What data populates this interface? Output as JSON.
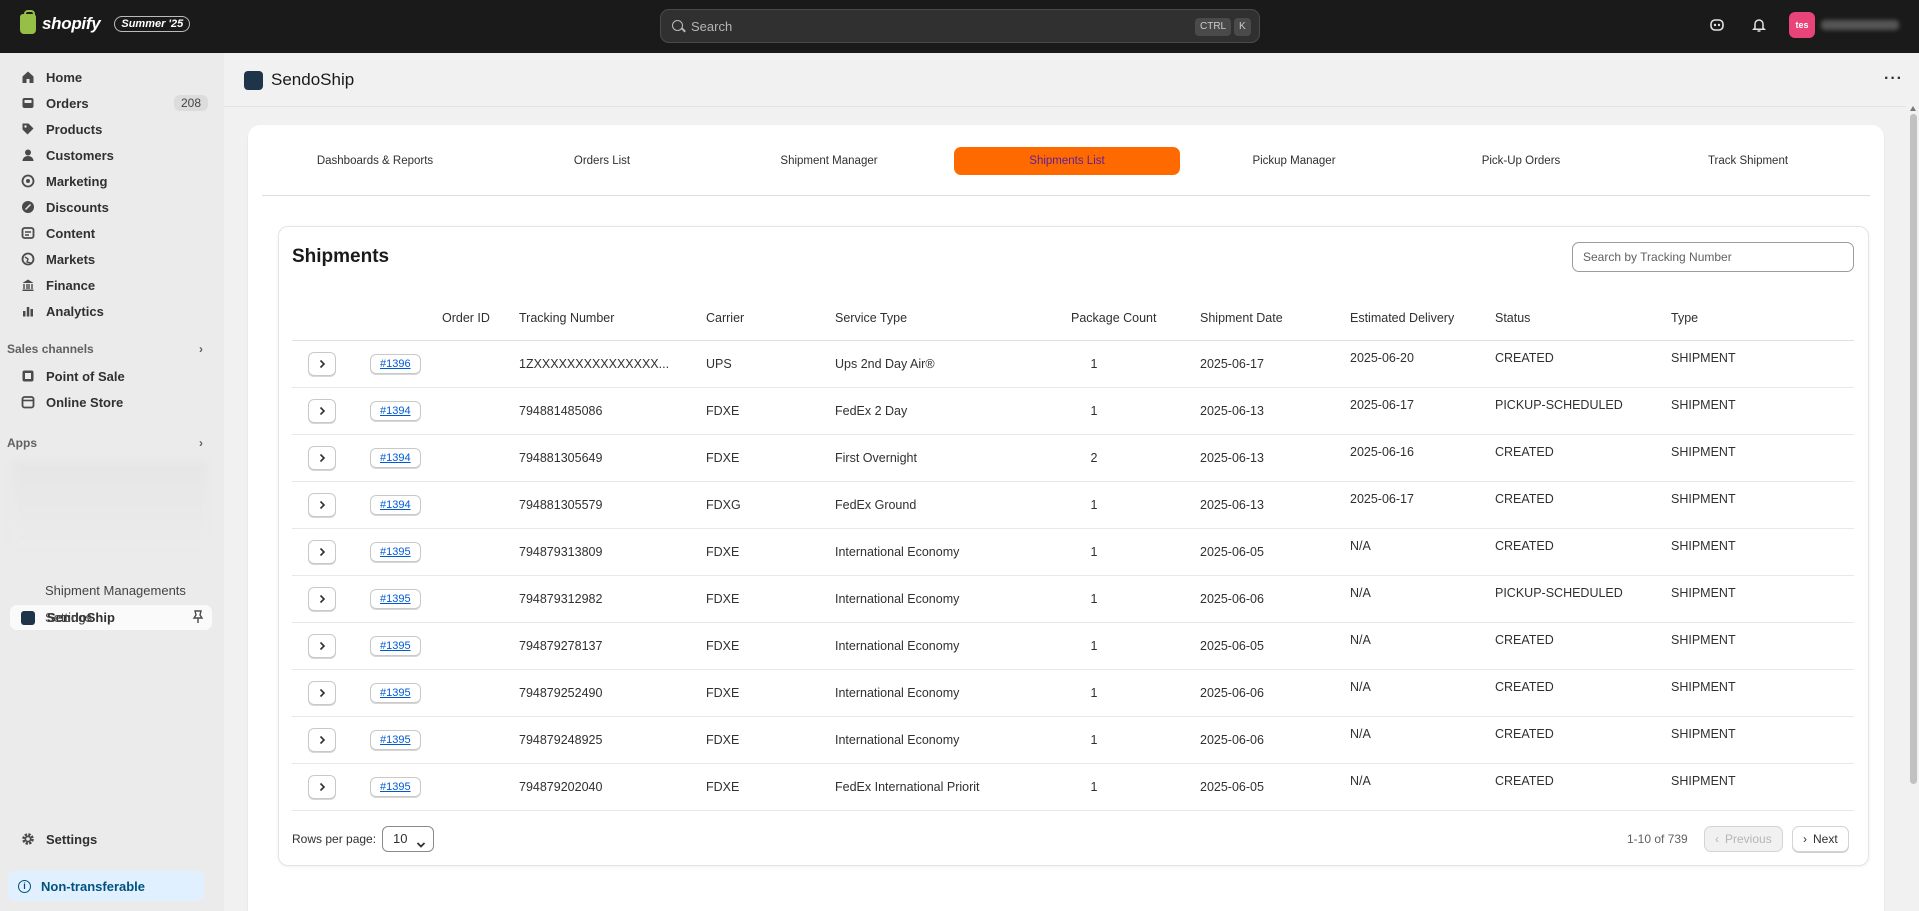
{
  "topbar": {
    "brand": "shopify",
    "edition": "Summer '25",
    "search_placeholder": "Search",
    "kbd1": "CTRL",
    "kbd2": "K",
    "avatar_initials": "tes"
  },
  "sidebar": {
    "items": [
      {
        "label": "Home",
        "icon": "home-icon"
      },
      {
        "label": "Orders",
        "icon": "inbox-icon",
        "badge": "208"
      },
      {
        "label": "Products",
        "icon": "tag-icon"
      },
      {
        "label": "Customers",
        "icon": "person-icon"
      },
      {
        "label": "Marketing",
        "icon": "target-icon"
      },
      {
        "label": "Discounts",
        "icon": "discount-icon"
      },
      {
        "label": "Content",
        "icon": "content-icon"
      },
      {
        "label": "Markets",
        "icon": "globe-icon"
      },
      {
        "label": "Finance",
        "icon": "bank-icon"
      },
      {
        "label": "Analytics",
        "icon": "chart-icon"
      }
    ],
    "sales_channels_label": "Sales channels",
    "channels": [
      {
        "label": "Point of Sale"
      },
      {
        "label": "Online Store"
      }
    ],
    "apps_label": "Apps",
    "app_name": "SendoShip",
    "app_sub": [
      "Shipment Managements",
      "Settings"
    ],
    "settings_label": "Settings",
    "nontransferable_label": "Non-transferable"
  },
  "app": {
    "title": "SendoShip",
    "tabs": [
      "Dashboards & Reports",
      "Orders List",
      "Shipment Manager",
      "Shipments List",
      "Pickup Manager",
      "Pick-Up Orders",
      "Track Shipment"
    ],
    "active_tab": "Shipments List"
  },
  "shipments": {
    "title": "Shipments",
    "search_placeholder": "Search by Tracking Number",
    "columns": [
      "Order ID",
      "Tracking Number",
      "Carrier",
      "Service Type",
      "Package Count",
      "Shipment Date",
      "Estimated Delivery",
      "Status",
      "Type"
    ],
    "rows": [
      {
        "order": "#1396",
        "tracking": "1ZXXXXXXXXXXXXXXX...",
        "carrier": "UPS",
        "service": "Ups 2nd Day Air®",
        "count": "1",
        "date": "2025-06-17",
        "eta": "2025-06-20",
        "status": "CREATED",
        "type": "SHIPMENT"
      },
      {
        "order": "#1394",
        "tracking": "794881485086",
        "carrier": "FDXE",
        "service": "FedEx 2 Day",
        "count": "1",
        "date": "2025-06-13",
        "eta": "2025-06-17",
        "status": "PICKUP-SCHEDULED",
        "type": "SHIPMENT"
      },
      {
        "order": "#1394",
        "tracking": "794881305649",
        "carrier": "FDXE",
        "service": "First Overnight",
        "count": "2",
        "date": "2025-06-13",
        "eta": "2025-06-16",
        "status": "CREATED",
        "type": "SHIPMENT"
      },
      {
        "order": "#1394",
        "tracking": "794881305579",
        "carrier": "FDXG",
        "service": "FedEx Ground",
        "count": "1",
        "date": "2025-06-13",
        "eta": "2025-06-17",
        "status": "CREATED",
        "type": "SHIPMENT"
      },
      {
        "order": "#1395",
        "tracking": "794879313809",
        "carrier": "FDXE",
        "service": "International Economy",
        "count": "1",
        "date": "2025-06-05",
        "eta": "N/A",
        "status": "CREATED",
        "type": "SHIPMENT"
      },
      {
        "order": "#1395",
        "tracking": "794879312982",
        "carrier": "FDXE",
        "service": "International Economy",
        "count": "1",
        "date": "2025-06-06",
        "eta": "N/A",
        "status": "PICKUP-SCHEDULED",
        "type": "SHIPMENT"
      },
      {
        "order": "#1395",
        "tracking": "794879278137",
        "carrier": "FDXE",
        "service": "International Economy",
        "count": "1",
        "date": "2025-06-05",
        "eta": "N/A",
        "status": "CREATED",
        "type": "SHIPMENT"
      },
      {
        "order": "#1395",
        "tracking": "794879252490",
        "carrier": "FDXE",
        "service": "International Economy",
        "count": "1",
        "date": "2025-06-06",
        "eta": "N/A",
        "status": "CREATED",
        "type": "SHIPMENT"
      },
      {
        "order": "#1395",
        "tracking": "794879248925",
        "carrier": "FDXE",
        "service": "International Economy",
        "count": "1",
        "date": "2025-06-06",
        "eta": "N/A",
        "status": "CREATED",
        "type": "SHIPMENT"
      },
      {
        "order": "#1395",
        "tracking": "794879202040",
        "carrier": "FDXE",
        "service": "FedEx International Priorit",
        "count": "1",
        "date": "2025-06-05",
        "eta": "N/A",
        "status": "CREATED",
        "type": "SHIPMENT"
      }
    ],
    "rows_per_page_label": "Rows per page:",
    "rows_per_page_value": "10",
    "pagination_info": "1-10 of 739",
    "prev_label": "Previous",
    "next_label": "Next"
  },
  "colors": {
    "active_tab_bg": "#ff6a00",
    "active_tab_text": "#5c1e9e",
    "link": "#005bd3"
  }
}
